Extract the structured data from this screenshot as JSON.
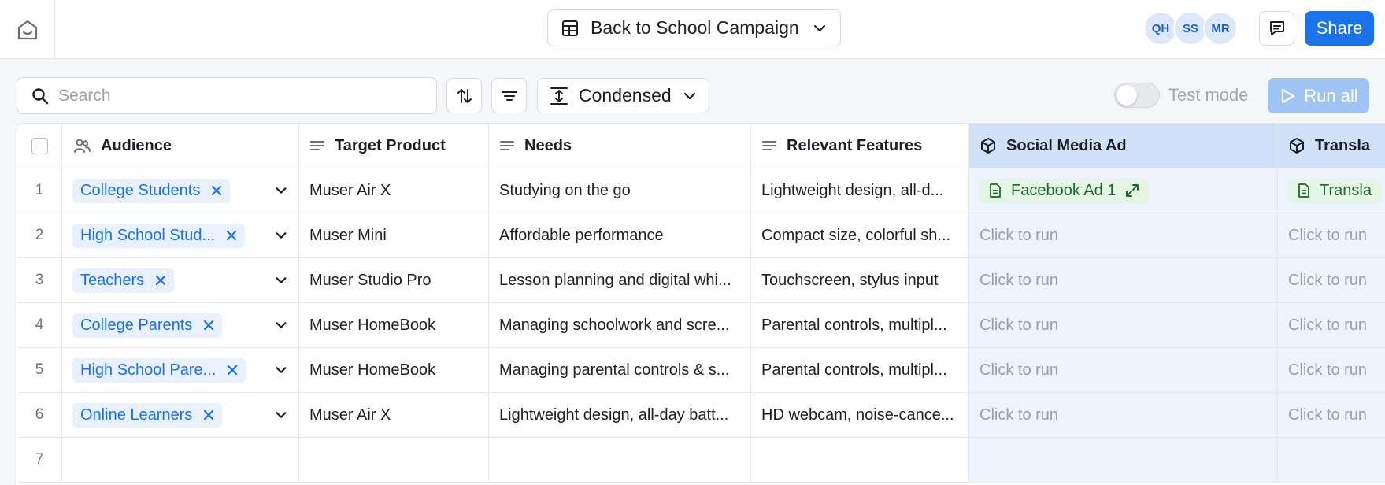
{
  "topbar": {
    "doc_title": "Back to School Campaign",
    "avatars": [
      "QH",
      "SS",
      "MR"
    ],
    "share_label": "Share"
  },
  "toolbar": {
    "search_placeholder": "Search",
    "density_label": "Condensed",
    "test_mode_label": "Test mode",
    "test_mode_on": false,
    "run_all_label": "Run all"
  },
  "grid": {
    "columns": [
      {
        "label": "Audience",
        "icon": "people-icon"
      },
      {
        "label": "Target Product",
        "icon": "text-lines-icon"
      },
      {
        "label": "Needs",
        "icon": "text-lines-icon"
      },
      {
        "label": "Relevant Features",
        "icon": "text-lines-icon"
      },
      {
        "label": "Social Media Ad",
        "icon": "cube-icon"
      },
      {
        "label": "Transla",
        "icon": "cube-icon"
      }
    ],
    "rows": [
      {
        "num": "1",
        "audience": "College Students",
        "product": "Muser Air X",
        "needs": "Studying on the go",
        "features": "Lightweight design, all-d...",
        "ad": "Facebook Ad 1",
        "translation": "Transla"
      },
      {
        "num": "2",
        "audience": "High School Stud...",
        "product": "Muser Mini",
        "needs": "Affordable performance",
        "features": "Compact size, colorful sh...",
        "ad": "Click to run",
        "translation": "Click to run"
      },
      {
        "num": "3",
        "audience": "Teachers",
        "product": "Muser Studio Pro",
        "needs": "Lesson planning and digital whi...",
        "features": "Touchscreen, stylus input",
        "ad": "Click to run",
        "translation": "Click to run"
      },
      {
        "num": "4",
        "audience": "College Parents",
        "product": "Muser HomeBook",
        "needs": "Managing schoolwork and scre...",
        "features": "Parental controls, multipl...",
        "ad": "Click to run",
        "translation": "Click to run"
      },
      {
        "num": "5",
        "audience": "High School Pare...",
        "product": "Muser HomeBook",
        "needs": "Managing parental controls & s...",
        "features": "Parental controls, multipl...",
        "ad": "Click to run",
        "translation": "Click to run"
      },
      {
        "num": "6",
        "audience": "Online Learners",
        "product": "Muser Air X",
        "needs": "Lightweight design, all-day batt...",
        "features": "HD webcam, noise-cance...",
        "ad": "Click to run",
        "translation": "Click to run"
      },
      {
        "num": "7",
        "audience": "",
        "product": "",
        "needs": "",
        "features": "",
        "ad": "",
        "translation": ""
      }
    ]
  },
  "colors": {
    "accent": "#1a73e8",
    "run_all_disabled": "#9fc3f2",
    "ai_column_header": "#cfe0f9",
    "ai_column_body": "#eef4fd",
    "result_chip": "#e6f6e6"
  }
}
